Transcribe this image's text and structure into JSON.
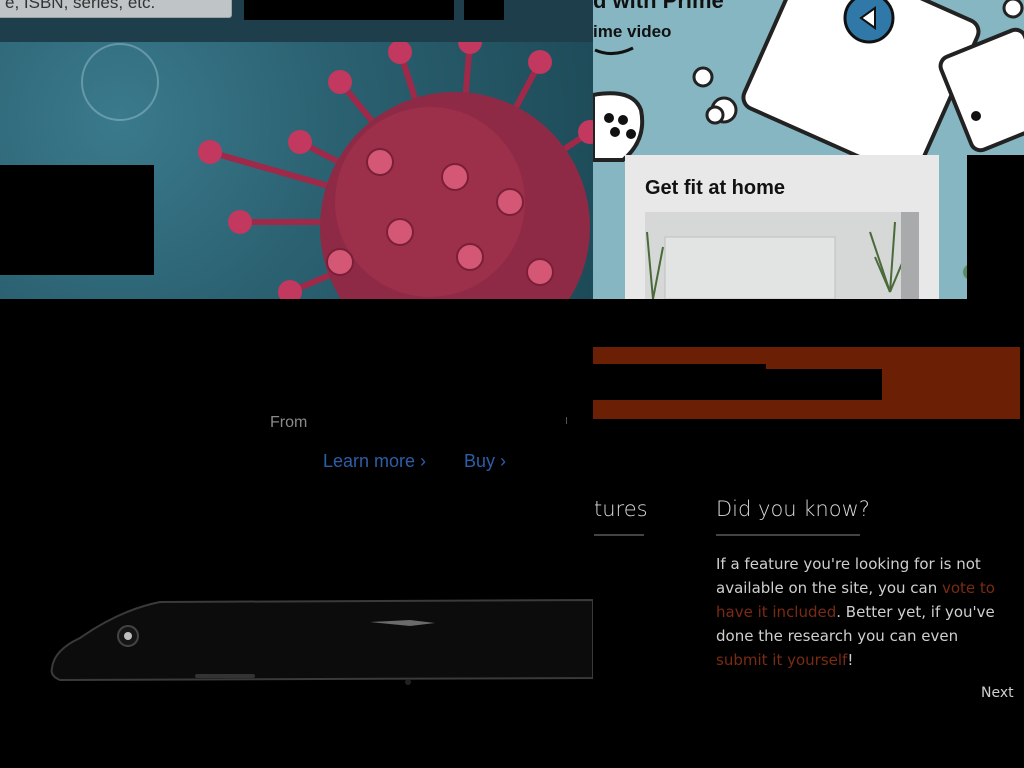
{
  "header": {
    "search_text": "e, ISBN, series, etc."
  },
  "prime": {
    "heading": "d with Prime",
    "video_label": "ime video"
  },
  "fit_card": {
    "title": "Get fit at home"
  },
  "iphone_promo": {
    "from_label": "From",
    "learn_more": "Learn more ›",
    "buy": "Buy ›"
  },
  "features": {
    "heading": "tures"
  },
  "did_you_know": {
    "heading": "Did you know?",
    "body_part1": "If a feature you're looking for is not available on the site, you can ",
    "link1": "vote to have it included",
    "body_part2": ". Better yet, if you've done the research you can even ",
    "link2": "submit it yourself",
    "body_part3": "!",
    "next": "Next"
  },
  "colors": {
    "link_blue": "#2d5ea8",
    "banner_orange": "#6b1f05",
    "dyk_link": "#7a2b12"
  }
}
